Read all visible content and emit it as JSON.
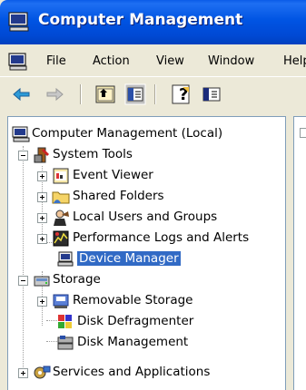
{
  "window": {
    "title": "Computer Management"
  },
  "menu": {
    "items": [
      {
        "label": "File"
      },
      {
        "label": "Action"
      },
      {
        "label": "View"
      },
      {
        "label": "Window"
      },
      {
        "label": "Help"
      }
    ]
  },
  "toolbar": {
    "buttons": [
      {
        "icon": "back-arrow-icon"
      },
      {
        "icon": "forward-arrow-icon"
      },
      {
        "icon": "up-folder-icon"
      },
      {
        "icon": "show-hide-tree-icon"
      },
      {
        "icon": "help-icon"
      },
      {
        "icon": "console-pane-icon"
      }
    ]
  },
  "tree": {
    "root": "Computer Management (Local)",
    "system_tools": {
      "label": "System Tools",
      "children": [
        "Event Viewer",
        "Shared Folders",
        "Local Users and Groups",
        "Performance Logs and Alerts",
        "Device Manager"
      ]
    },
    "storage": {
      "label": "Storage",
      "children": [
        "Removable Storage",
        "Disk Defragmenter",
        "Disk Management"
      ]
    },
    "services": {
      "label": "Services and Applications"
    },
    "selected": "Device Manager"
  },
  "colors": {
    "title_bar": "#0054e3",
    "selection": "#316ac5",
    "chrome": "#ece9d8"
  }
}
